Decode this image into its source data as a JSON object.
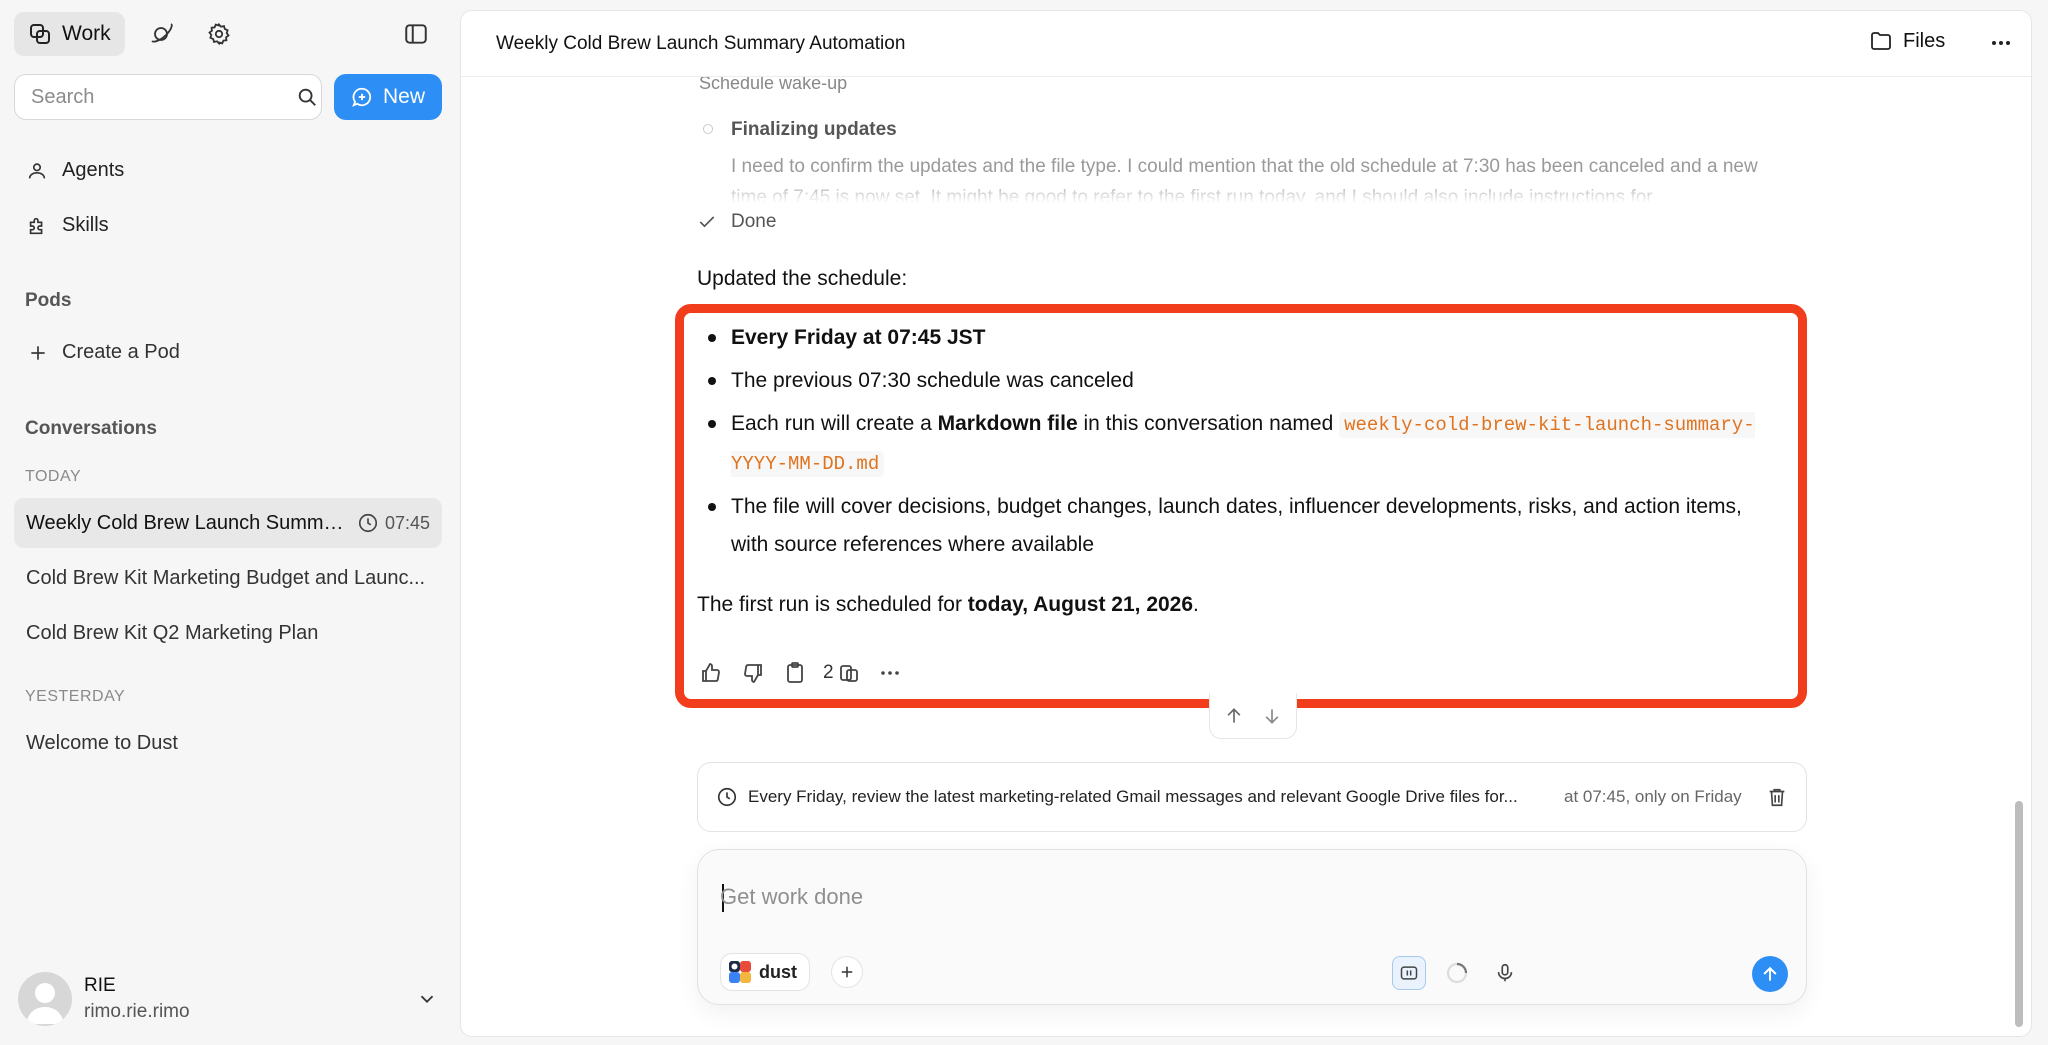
{
  "sidebar": {
    "work_tab": "Work",
    "search_placeholder": "Search",
    "new_label": "New",
    "nav": [
      {
        "label": "Agents",
        "icon": "person-icon"
      },
      {
        "label": "Skills",
        "icon": "puzzle-icon"
      }
    ],
    "pods_title": "Pods",
    "create_pod": "Create a Pod",
    "conversations_title": "Conversations",
    "groups": [
      {
        "label": "TODAY",
        "items": [
          {
            "title": "Weekly Cold Brew Launch Summa...",
            "time": "07:45"
          },
          {
            "title": "Cold Brew Kit Marketing Budget and Launc..."
          },
          {
            "title": "Cold Brew Kit Q2 Marketing Plan"
          }
        ]
      },
      {
        "label": "YESTERDAY",
        "items": [
          {
            "title": "Welcome to Dust"
          }
        ]
      }
    ],
    "user": {
      "name": "RIE",
      "email": "rimo.rie.rimo"
    }
  },
  "header": {
    "title": "Weekly Cold Brew Launch Summary Automation",
    "files_label": "Files"
  },
  "thread": {
    "faded_step": "Schedule wake-up",
    "step_title": "Finalizing updates",
    "step_body": "I need to confirm the updates and the file type. I could mention that the old schedule at 7:30 has been canceled and a new time of 7:45 is now set. It might be good to refer to the first run today, and I should also include instructions for",
    "done_label": "Done",
    "intro": "Updated the schedule:",
    "bullet1": "Every Friday at 07:45 JST",
    "bullet2": "The previous 07:30 schedule was canceled",
    "bullet3_a": "Each run will create a ",
    "bullet3_b": "Markdown file",
    "bullet3_c": " in this conversation named ",
    "bullet3_code": "weekly-cold-brew-kit-launch-summary-YYYY-MM-DD.md",
    "bullet4": "The file will cover decisions, budget changes, launch dates, influencer developments, risks, and action items, with source references where available",
    "first_run_a": "The first run is scheduled for ",
    "first_run_b": "today, August 21, 2026",
    "first_run_c": ".",
    "sources_count": "2"
  },
  "schedule": {
    "text": "Every Friday, review the latest marketing-related Gmail messages and relevant Google Drive files for...",
    "when": "at 07:45, only on Friday"
  },
  "composer": {
    "placeholder": "Get work done",
    "agent": "dust"
  },
  "colors": {
    "accent": "#2d8ef5",
    "highlight": "#f23d1c",
    "code": "#e0731f"
  }
}
